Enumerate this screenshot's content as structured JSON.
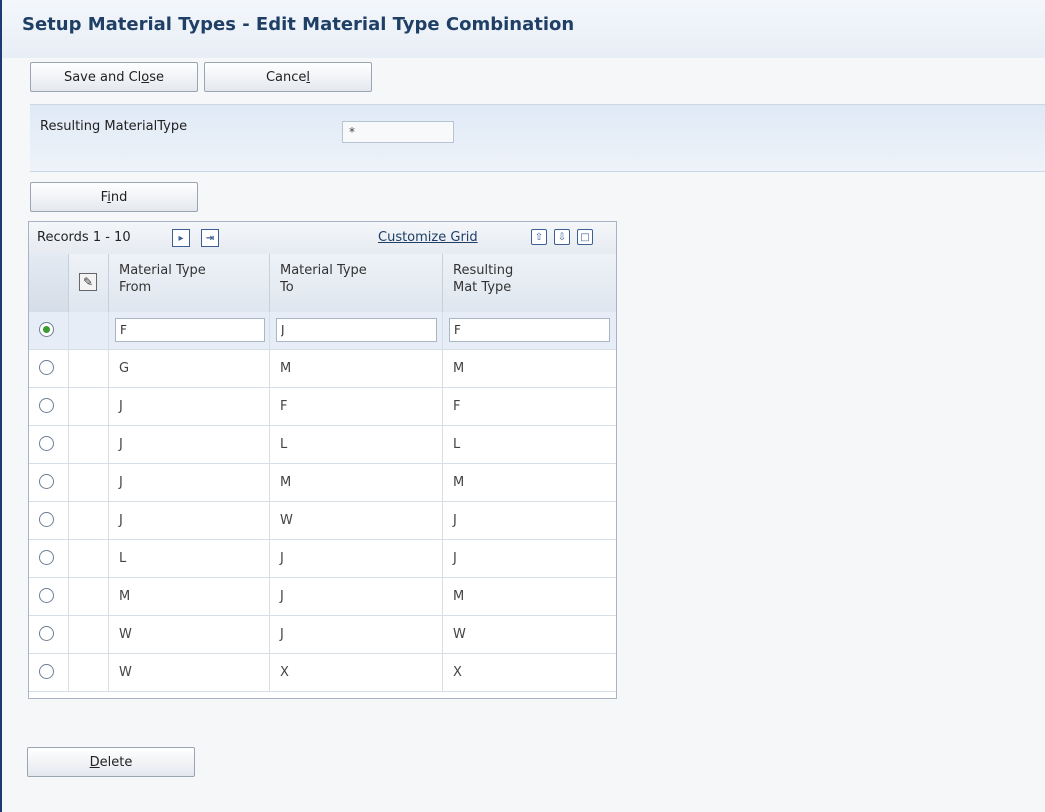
{
  "title": "Setup Material Types - Edit Material Type Combination",
  "toolbar": {
    "save_close_pre": "Save and Cl",
    "save_close_ul": "o",
    "save_close_post": "se",
    "cancel_pre": "Cance",
    "cancel_ul": "l"
  },
  "filter": {
    "label": "Resulting MaterialType",
    "value": "*"
  },
  "find": {
    "pre": "F",
    "ul": "i",
    "post": "nd"
  },
  "grid": {
    "records": "Records 1 - 10",
    "customize": "Customize Grid",
    "columns": [
      {
        "line1": "Material Type",
        "line2": "From"
      },
      {
        "line1": "Material Type",
        "line2": "To"
      },
      {
        "line1": "Resulting",
        "line2": "Mat Type"
      }
    ],
    "rows": [
      {
        "from": "F",
        "to": "J",
        "result": "F"
      },
      {
        "from": "G",
        "to": "M",
        "result": "M"
      },
      {
        "from": "J",
        "to": "F",
        "result": "F"
      },
      {
        "from": "J",
        "to": "L",
        "result": "L"
      },
      {
        "from": "J",
        "to": "M",
        "result": "M"
      },
      {
        "from": "J",
        "to": "W",
        "result": "J"
      },
      {
        "from": "L",
        "to": "J",
        "result": "J"
      },
      {
        "from": "M",
        "to": "J",
        "result": "M"
      },
      {
        "from": "W",
        "to": "J",
        "result": "W"
      },
      {
        "from": "W",
        "to": "X",
        "result": "X"
      }
    ]
  },
  "delete": {
    "ul": "D",
    "post": "elete"
  },
  "icons": {
    "next": "▸",
    "last": "⇥",
    "export": "⇧",
    "import": "⇩",
    "maximize": "□",
    "attachment": "✎"
  }
}
